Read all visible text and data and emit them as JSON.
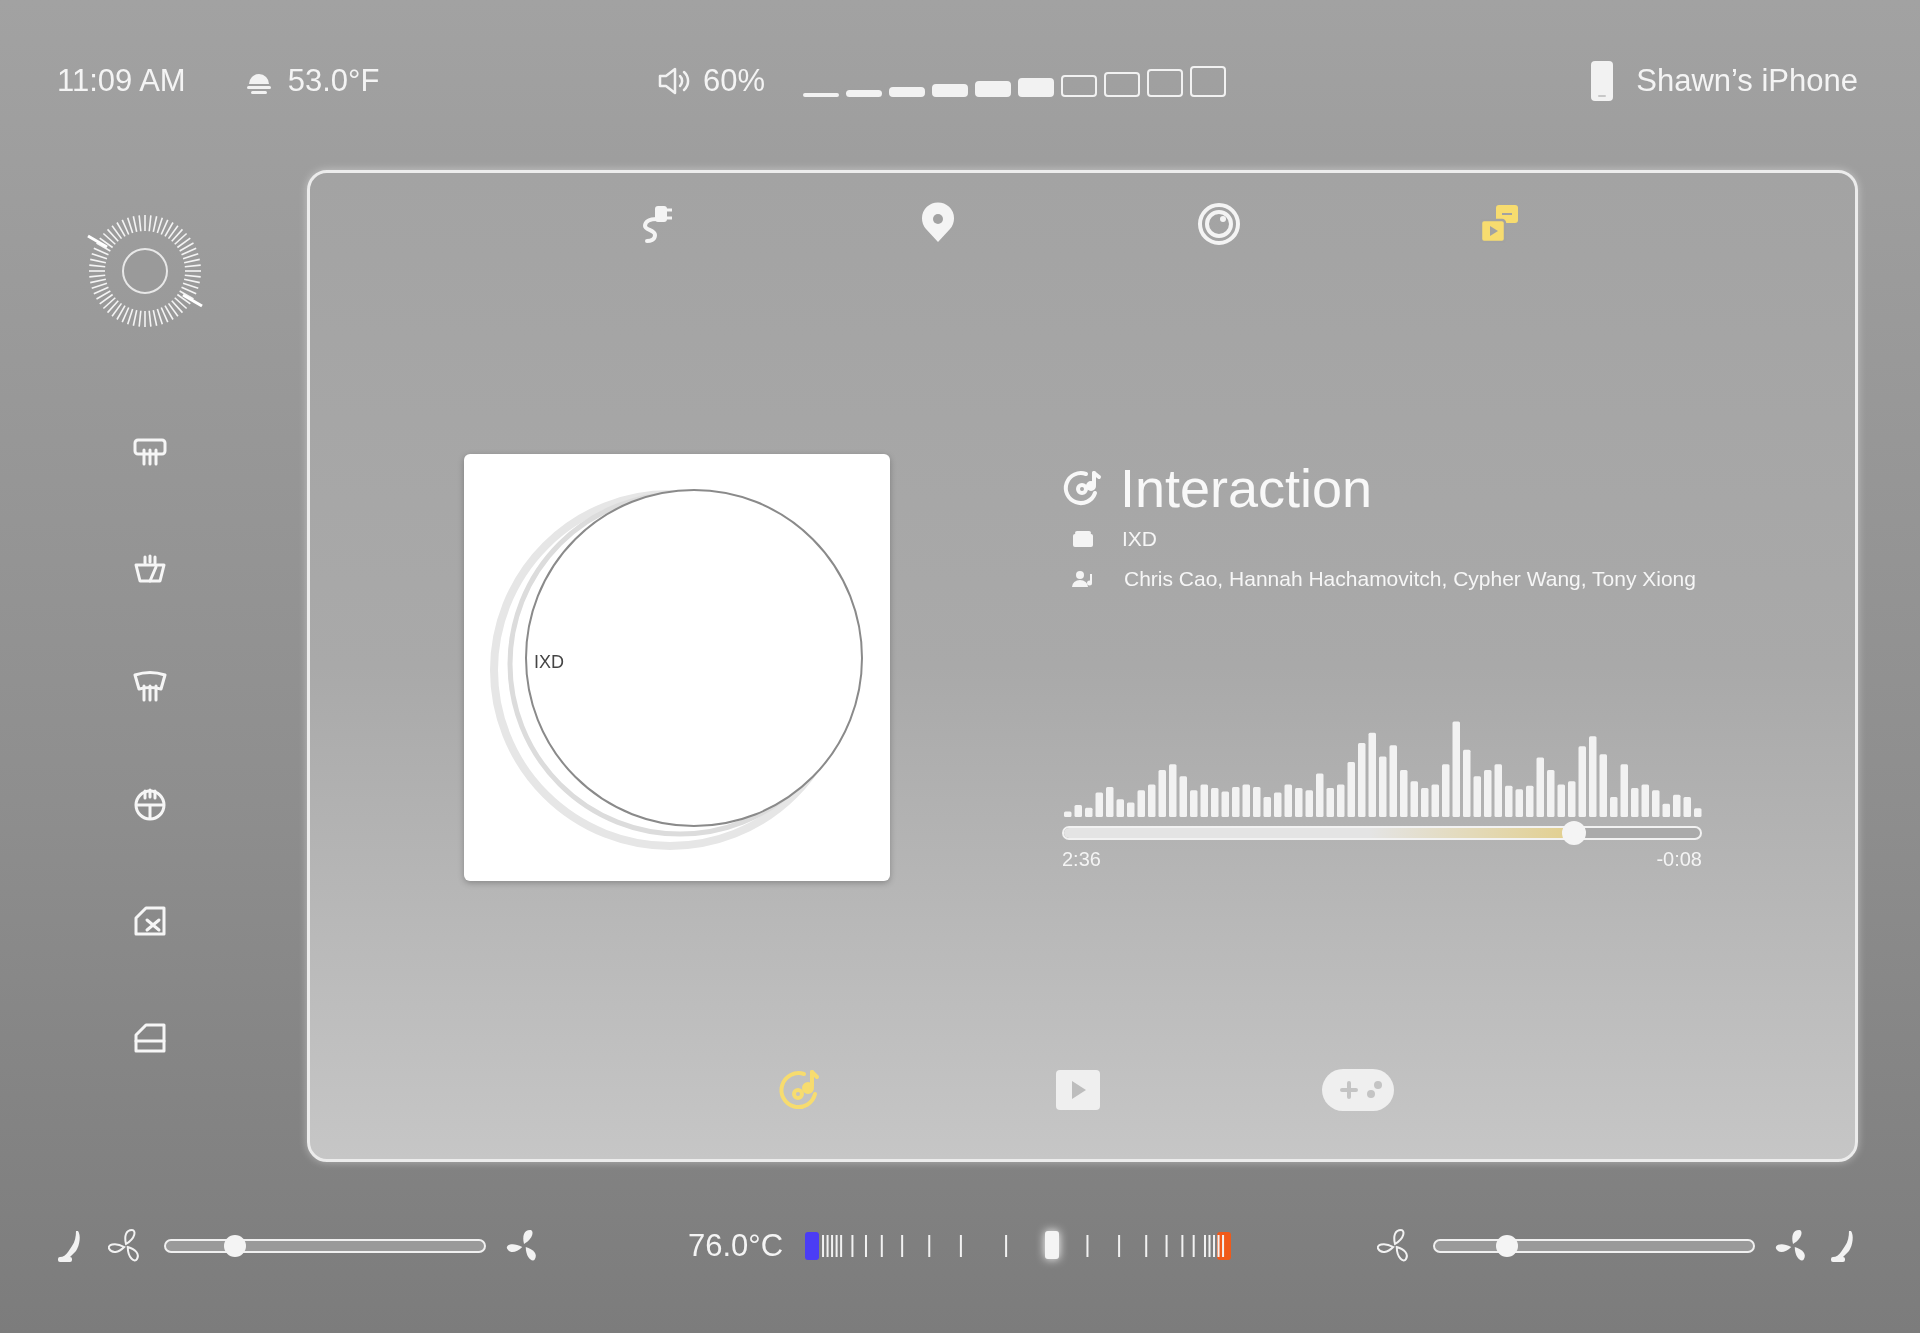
{
  "status_bar": {
    "time": "11:09 AM",
    "temperature": "53.0°F",
    "volume": {
      "reading": "60%",
      "level": 0.6
    },
    "device": "Shawn’s iPhone"
  },
  "sidebar": {
    "items": [
      {
        "kind": "rear-defrost"
      },
      {
        "kind": "wiper-heat"
      },
      {
        "kind": "front-defrost"
      },
      {
        "kind": "wheel-heat"
      },
      {
        "kind": "window-lock"
      },
      {
        "kind": "window"
      }
    ]
  },
  "top_tabs": [
    {
      "kind": "charging",
      "selected": false
    },
    {
      "kind": "map",
      "selected": false
    },
    {
      "kind": "camera",
      "selected": false
    },
    {
      "kind": "media",
      "selected": true
    }
  ],
  "now_playing": {
    "album_art": {
      "label": "IXD"
    },
    "title": "Interaction",
    "album": "IXD",
    "artists": "Chris Cao, Hannah Hachamovitch, Cypher Wang, Tony Xiong",
    "progress": {
      "level": 0.8,
      "elapsed": "2:36",
      "remaining": "-0:08"
    }
  },
  "bottom_tabs": [
    {
      "kind": "music",
      "selected": true
    },
    {
      "kind": "video",
      "selected": false
    },
    {
      "kind": "games",
      "selected": false
    }
  ],
  "climate": {
    "left_fan": {
      "level": 0.22
    },
    "temperature": "76.0°C",
    "temperature_slider": {
      "level": 0.58
    },
    "right_fan": {
      "level": 0.23
    }
  }
}
